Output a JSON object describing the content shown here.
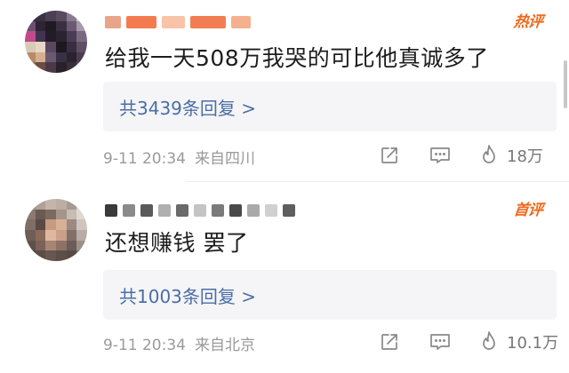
{
  "comments": [
    {
      "badge": "热评",
      "text": "给我一天508万我哭的可比他真诚多了",
      "replies_label": "共3439条回复 >",
      "time": "9-11 20:34",
      "location": "来自四川",
      "likes": "18万"
    },
    {
      "badge": "首评",
      "text": "还想赚钱 罢了",
      "replies_label": "共1003条回复 >",
      "time": "9-11 20:34",
      "location": "来自北京",
      "likes": "10.1万"
    }
  ],
  "icons": {
    "share": "share-icon",
    "reply": "comment-icon",
    "like": "flame-like-icon"
  },
  "colors": {
    "badge": "#ef6a1e",
    "reply_link": "#4a6ea5",
    "meta": "#9a9a9a",
    "reply_box_bg": "#f5f5f7"
  }
}
